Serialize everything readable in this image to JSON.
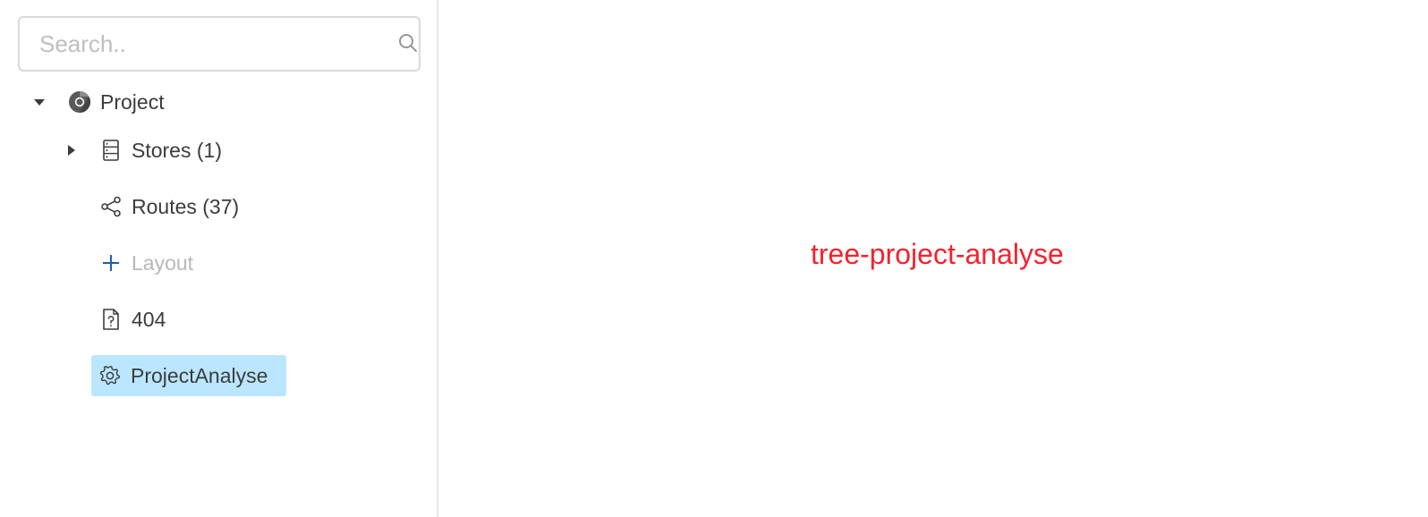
{
  "search": {
    "placeholder": "Search..",
    "value": ""
  },
  "tree": {
    "root": {
      "label": "Project",
      "expanded": true,
      "icon": "chrome-icon"
    },
    "children": [
      {
        "label": "Stores (1)",
        "icon": "database-icon",
        "expandable": true,
        "expanded": false
      },
      {
        "label": "Routes (37)",
        "icon": "share-icon",
        "expandable": false
      },
      {
        "label": "Layout",
        "icon": "plus-icon",
        "expandable": false,
        "muted": true
      },
      {
        "label": "404",
        "icon": "file-unknown-icon",
        "expandable": false
      },
      {
        "label": "ProjectAnalyse",
        "icon": "gear-icon",
        "expandable": false,
        "selected": true
      }
    ]
  },
  "content": {
    "text": "tree-project-analyse"
  },
  "colors": {
    "selected_bg": "#bae7ff",
    "accent_text": "#f5222d",
    "plus_icon": "#1f5ea8",
    "muted_text": "#b8b8b8"
  }
}
